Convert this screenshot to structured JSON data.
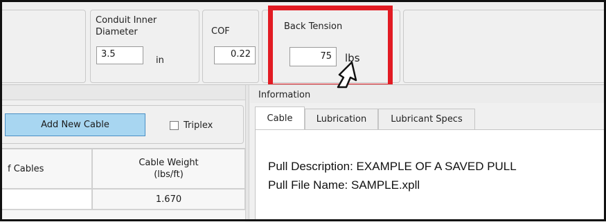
{
  "params": {
    "conduit_label": "Conduit Inner Diameter",
    "conduit_value": "3.5",
    "conduit_unit": "in",
    "cof_label": "COF",
    "cof_value": "0.22",
    "back_tension_label": "Back Tension",
    "back_tension_value": "75",
    "back_tension_unit": "lbs"
  },
  "cables": {
    "add_button": "Add New Cable",
    "triplex_label": "Triplex",
    "triplex_checked": false,
    "columns": [
      "f Cables",
      "Cable Weight\n(lbs/ft)"
    ],
    "rows": [
      [
        "",
        "1.670"
      ]
    ]
  },
  "information": {
    "title": "Information",
    "tabs": [
      "Cable",
      "Lubrication",
      "Lubricant Specs"
    ],
    "active_tab": "Cable",
    "pull_description": "Pull Description: EXAMPLE OF A SAVED PULL",
    "pull_file_name": "Pull File Name: SAMPLE.xpll"
  },
  "colors": {
    "highlight": "#e21b23",
    "button_accent": "#a8d6f1"
  },
  "icons": {
    "cursor": "hand-pointer-icon"
  }
}
